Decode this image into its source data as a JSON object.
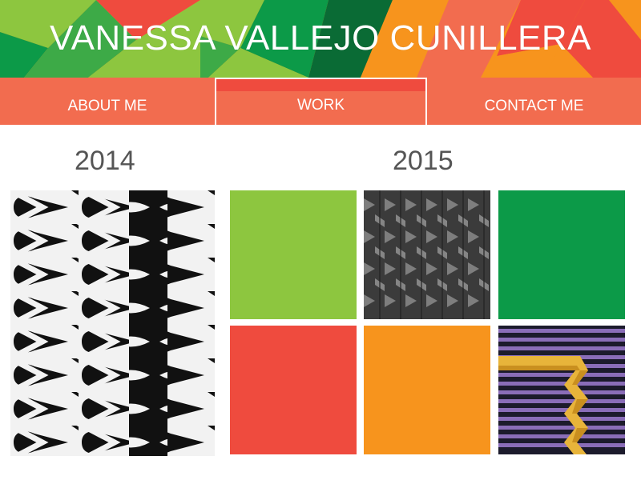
{
  "site": {
    "title": "VANESSA VALLEJO CUNILLERA"
  },
  "nav": {
    "items": [
      {
        "label": "ABOUT ME",
        "active": false
      },
      {
        "label": "WORK",
        "active": true
      },
      {
        "label": "CONTACT ME",
        "active": false
      }
    ]
  },
  "years": {
    "left": "2014",
    "right": "2015"
  },
  "colors": {
    "nav_bg": "#f26c4f",
    "nav_active_bar": "#ef4b3e",
    "lime": "#8dc63f",
    "green": "#0c9a48",
    "red": "#ef4b3e",
    "orange": "#f7941d",
    "heading": "#555555"
  },
  "tiles": [
    {
      "name": "drops-artwork",
      "kind": "image"
    },
    {
      "name": "lime-block",
      "kind": "color",
      "color": "#8dc63f"
    },
    {
      "name": "gray-chevron-artwork",
      "kind": "image"
    },
    {
      "name": "green-block",
      "kind": "color",
      "color": "#0c9a48"
    },
    {
      "name": "red-block",
      "kind": "color",
      "color": "#ef4b3e"
    },
    {
      "name": "orange-block",
      "kind": "color",
      "color": "#f7941d"
    },
    {
      "name": "purple-stripes-artwork",
      "kind": "image"
    }
  ]
}
